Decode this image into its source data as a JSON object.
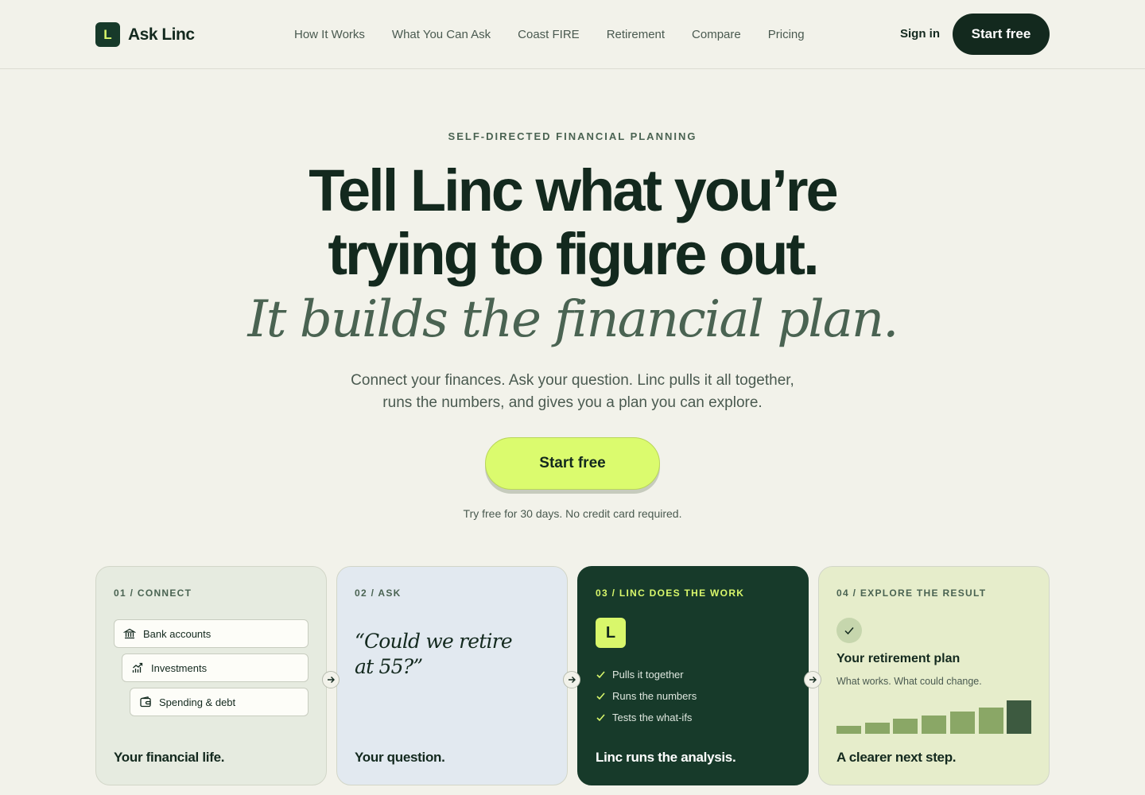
{
  "nav": {
    "logo_mark": "L",
    "logo_text": "Ask Linc",
    "links": [
      "How It Works",
      "What You Can Ask",
      "Coast FIRE",
      "Retirement",
      "Compare",
      "Pricing"
    ],
    "sign_in": "Sign in",
    "start_free": "Start free"
  },
  "hero": {
    "eyebrow": "SELF-DIRECTED FINANCIAL PLANNING",
    "headline_line1": "Tell Linc what you’re",
    "headline_line2": "trying to figure out.",
    "headline_italic": "It builds the financial plan.",
    "sub_line1": "Connect your finances. Ask your question. Linc pulls it all together,",
    "sub_line2": "runs the numbers, and gives you a plan you can explore.",
    "cta": "Start free",
    "trial_note": "Try free for 30 days. No credit card required."
  },
  "cards": {
    "connect": {
      "label": "01 / CONNECT",
      "accounts": [
        "Bank accounts",
        "Investments",
        "Spending & debt"
      ],
      "footer": "Your financial life."
    },
    "ask": {
      "label": "02 / ASK",
      "quote_line1": "“Could we retire",
      "quote_line2": "at 55?”",
      "footer": "Your question."
    },
    "work": {
      "label": "03 / LINC DOES THE WORK",
      "badge": "L",
      "checks": [
        "Pulls it together",
        "Runs the numbers",
        "Tests the what-ifs"
      ],
      "footer": "Linc runs the analysis."
    },
    "result": {
      "label": "04 / EXPLORE THE RESULT",
      "title": "Your retirement plan",
      "subtitle": "What works. What could change.",
      "bar_levels": [
        0.24,
        0.33,
        0.45,
        0.55,
        0.67,
        0.79,
        1.0
      ],
      "footer": "A clearer next step."
    }
  },
  "colors": {
    "brand_dark": "#13291e",
    "accent_lime": "#dbfb6e",
    "card_dark": "#173a2a"
  },
  "icons": {
    "bank": "bank-icon",
    "investments": "chart-icon",
    "spending": "wallet-icon",
    "check": "check-icon",
    "arrow": "arrow-right-icon"
  }
}
